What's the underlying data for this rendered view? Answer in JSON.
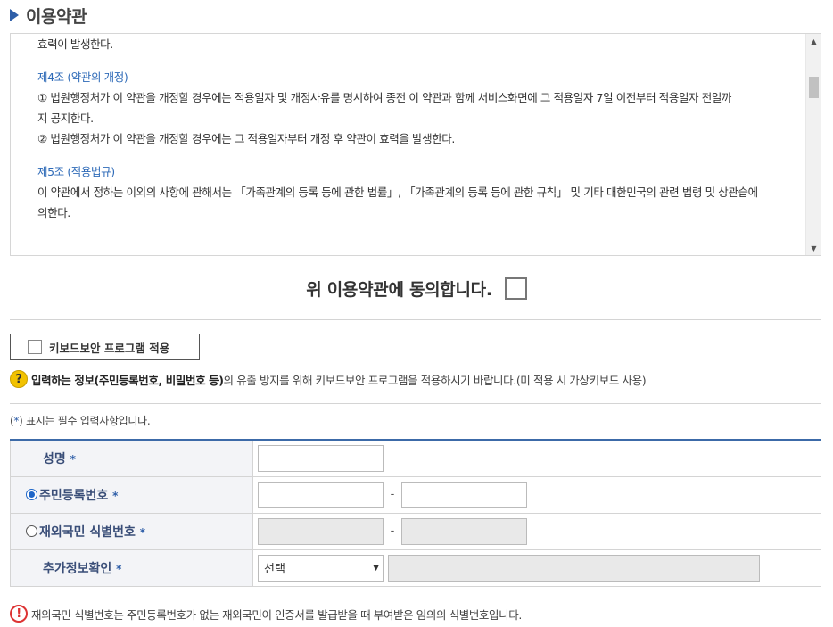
{
  "section": {
    "title": "이용약관"
  },
  "terms": {
    "lines": [
      {
        "type": "p",
        "text": "효력이 발생한다."
      },
      {
        "type": "h",
        "text": "제4조 (약관의 개정)"
      },
      {
        "type": "p",
        "text": "① 법원행정처가 이 약관을 개정할 경우에는 적용일자 및 개정사유를 명시하여 종전 이 약관과 함께 서비스화면에 그 적용일자 7일 이전부터 적용일자 전일까"
      },
      {
        "type": "p",
        "text": "지 공지한다."
      },
      {
        "type": "p",
        "text": "② 법원행정처가 이 약관을 개정할 경우에는 그 적용일자부터 개정 후 약관이 효력을 발생한다."
      },
      {
        "type": "h",
        "text": "제5조 (적용법규)"
      },
      {
        "type": "p",
        "text": "이 약관에서 정하는 이외의 사항에 관해서는 「가족관계의 등록 등에 관한 법률」, 「가족관계의 등록 등에 관한 규칙」 및 기타 대한민국의 관련 법령 및 상관습에"
      },
      {
        "type": "p",
        "text": "의한다."
      }
    ]
  },
  "agree": {
    "label": "위 이용약관에 동의합니다."
  },
  "keyboard": {
    "label": "키보드보안 프로그램 적용"
  },
  "info": {
    "bold": "입력하는 정보(주민등록번호, 비밀번호 등)",
    "normal": "의 유출 방지를 위해 키보드보안 프로그램을 적용하시기 바랍니다.(미 적용 시 가상키보드 사용)"
  },
  "required_note": {
    "prefix": "(",
    "star": "*",
    "suffix": ") 표시는 필수 입력사항입니다."
  },
  "form": {
    "name_label": "성명",
    "rrn_label": "주민등록번호",
    "overseas_label": "재외국민 식별번호",
    "extra_label": "추가정보확인",
    "star": "*",
    "dash": "-",
    "select_value": "선택"
  },
  "warning": {
    "text": "재외국민 식별번호는 주민등록번호가 없는 재외국민이 인증서를 발급받을 때 부여받은 임의의 식별번호입니다."
  },
  "colors": {
    "accent": "#2e5ea8",
    "heading_link": "#2f6bb8",
    "warning": "#dd3333",
    "help": "#f2c200"
  }
}
